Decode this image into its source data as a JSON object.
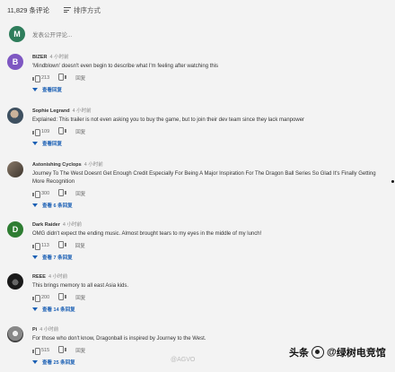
{
  "header": {
    "count_label": "11,829 条评论",
    "sort_label": "排序方式"
  },
  "add_comment": {
    "avatar_letter": "M",
    "avatar_color": "#2e7d5b",
    "placeholder": "发表公开评论..."
  },
  "comments": [
    {
      "author": "BIZER",
      "time": "4 小时前",
      "avatar_letter": "B",
      "avatar_color": "#7e57c2",
      "text": "'Mindblown' doesn't even begin to describe what I'm feeling after watching this",
      "likes": "213",
      "reply": "回复",
      "replies_label": "查看回复"
    },
    {
      "author": "Sophie Legrand",
      "time": "4 小时前",
      "avatar_letter": "",
      "avatar_color": "",
      "text": "Explained: This trailer is not even asking you to buy the game, but to join their dev team since they lack manpower",
      "likes": "109",
      "reply": "回复",
      "replies_label": "查看回复"
    },
    {
      "author": "Astonishing Cyclops",
      "time": "4 小时前",
      "avatar_letter": "",
      "avatar_color": "",
      "text": "Journey To The West Doesnt Get Enough Credit Especially For Being A Major Inspiration For The Dragon Ball Series So Glad It's Finally Getting More Recognition",
      "likes": "300",
      "reply": "回复",
      "replies_label": "查看 6 条回复"
    },
    {
      "author": "Dark Raider",
      "time": "4 小时前",
      "avatar_letter": "D",
      "avatar_color": "#2e7d32",
      "text": "OMG didn't expect the ending music. Almost brought tears to my eyes in the middle of my lunch!",
      "likes": "113",
      "reply": "回复",
      "replies_label": "查看 7 条回复"
    },
    {
      "author": "REEE",
      "time": "4 小时前",
      "avatar_letter": "",
      "avatar_color": "",
      "text": "This brings memory to all east Asia kids.",
      "likes": "200",
      "reply": "回复",
      "replies_label": "查看 14 条回复"
    },
    {
      "author": "Pi",
      "time": "4 小时前",
      "avatar_letter": "",
      "avatar_color": "",
      "text": "For those who don't know, Dragonball is inspired by Journey to the West.",
      "likes": "515",
      "reply": "回复",
      "replies_label": "查看 25 条回复"
    }
  ],
  "watermark": {
    "prefix": "头条",
    "at": "@",
    "name": "绿树电竞馆"
  },
  "weibo": "@AGVO"
}
